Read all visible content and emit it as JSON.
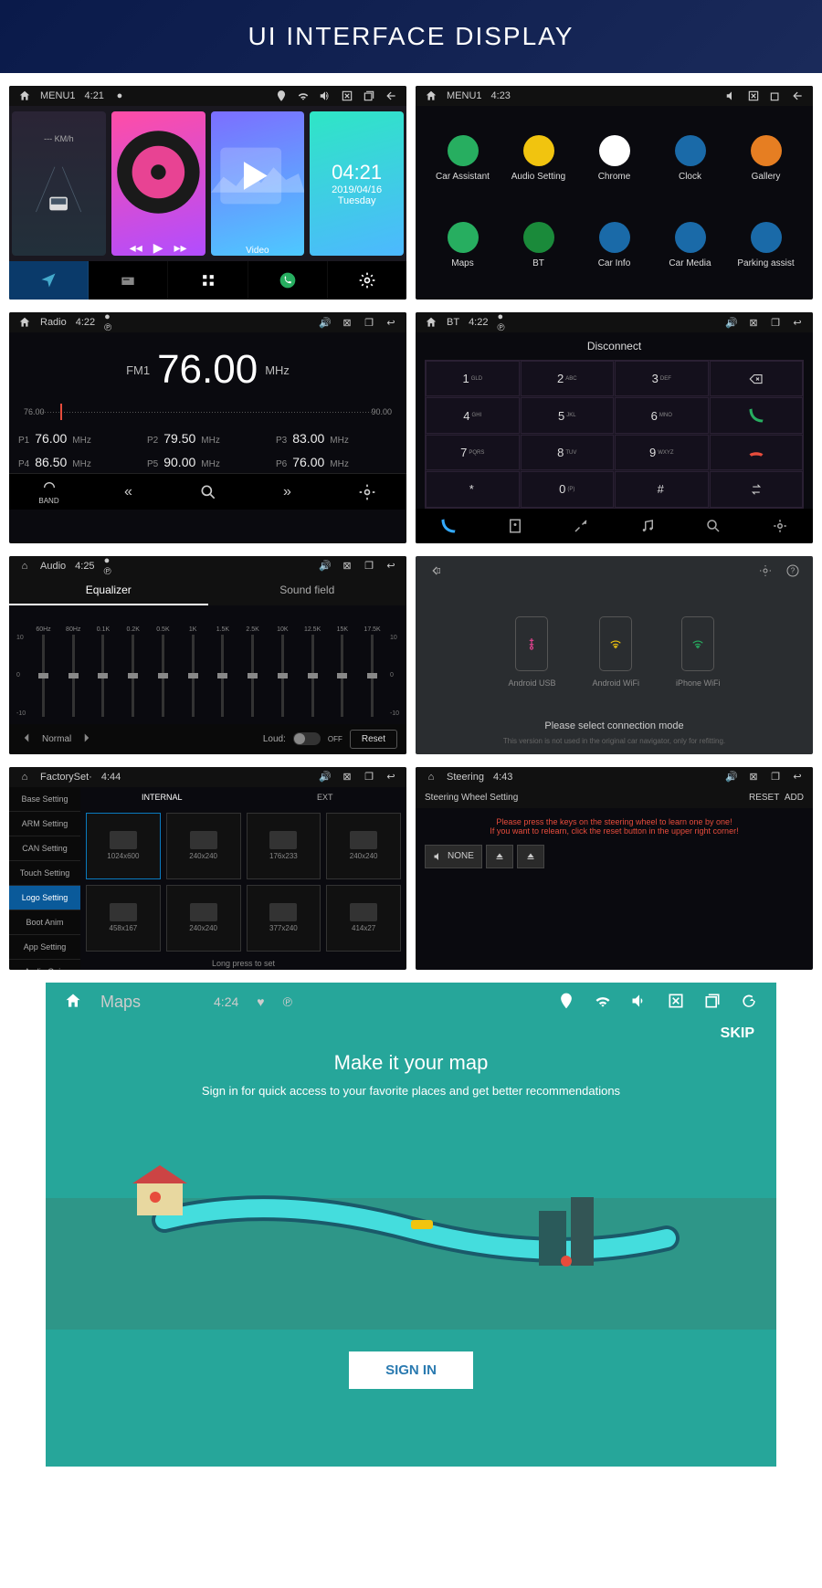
{
  "hero": "UI INTERFACE DISPLAY",
  "p1": {
    "sb_label": "MENU1",
    "sb_time": "4:21",
    "speed_unit": "KM/h",
    "video_label": "Video",
    "date_time": "04:21",
    "date_date": "2019/04/16",
    "date_day": "Tuesday"
  },
  "p2": {
    "sb_label": "MENU1",
    "sb_time": "4:23",
    "apps": [
      {
        "name": "Car Assistant",
        "color": "#27ae60"
      },
      {
        "name": "Audio Setting",
        "color": "#f1c40f"
      },
      {
        "name": "Chrome",
        "color": "#fff"
      },
      {
        "name": "Clock",
        "color": "#1a6aa8"
      },
      {
        "name": "Gallery",
        "color": "#e67e22"
      },
      {
        "name": "Maps",
        "color": "#27ae60"
      },
      {
        "name": "BT",
        "color": "#1a8a3a"
      },
      {
        "name": "Car Info",
        "color": "#1a6aa8"
      },
      {
        "name": "Car Media",
        "color": "#1a6aa8"
      },
      {
        "name": "Parking assist",
        "color": "#1a6aa8"
      }
    ]
  },
  "p3": {
    "sb_label": "Radio",
    "sb_time": "4:22",
    "band": "FM1",
    "freq": "76.00",
    "unit": "MHz",
    "dial_min": "76.00",
    "dial_max": "90.00",
    "presets": [
      {
        "p": "P1",
        "f": "76.00",
        "u": "MHz"
      },
      {
        "p": "P2",
        "f": "79.50",
        "u": "MHz"
      },
      {
        "p": "P3",
        "f": "83.00",
        "u": "MHz"
      },
      {
        "p": "P4",
        "f": "86.50",
        "u": "MHz"
      },
      {
        "p": "P5",
        "f": "90.00",
        "u": "MHz"
      },
      {
        "p": "P6",
        "f": "76.00",
        "u": "MHz"
      }
    ],
    "band_label": "BAND"
  },
  "p4": {
    "sb_label": "BT",
    "sb_time": "4:22",
    "disconnect": "Disconnect",
    "keys": [
      [
        "1",
        "GLD"
      ],
      [
        "2",
        "ABC"
      ],
      [
        "3",
        "DEF"
      ],
      [
        "⌫",
        ""
      ],
      [
        "4",
        "GHI"
      ],
      [
        "5",
        "JKL"
      ],
      [
        "6",
        "MNO"
      ],
      [
        "call",
        ""
      ],
      [
        "7",
        "PQRS"
      ],
      [
        "8",
        "TUV"
      ],
      [
        "9",
        "WXYZ"
      ],
      [
        "end",
        ""
      ],
      [
        "*",
        ""
      ],
      [
        "0",
        "(P)"
      ],
      [
        "#",
        ""
      ],
      [
        "swap",
        ""
      ]
    ]
  },
  "p5": {
    "sb_label": "Audio",
    "sb_time": "4:25",
    "tab_eq": "Equalizer",
    "tab_sf": "Sound field",
    "bands": [
      "60Hz",
      "80Hz",
      "0.1K",
      "0.2K",
      "0.5K",
      "1K",
      "1.5K",
      "2.5K",
      "10K",
      "12.5K",
      "15K",
      "17.5K"
    ],
    "scale_top": "10",
    "scale_mid": "0",
    "scale_bot": "-10",
    "mode": "Normal",
    "loud": "Loud:",
    "off": "OFF",
    "reset": "Reset"
  },
  "p6": {
    "options": [
      {
        "name": "Android USB",
        "color": "#e84393"
      },
      {
        "name": "Android WiFi",
        "color": "#f1c40f"
      },
      {
        "name": "iPhone WiFi",
        "color": "#27ae60"
      }
    ],
    "msg": "Please select connection mode",
    "sub": "This version is not used in the original car navigator, only for refitting."
  },
  "p7": {
    "sb_label": "FactorySet·",
    "sb_time": "4:44",
    "side": [
      "Base Setting",
      "ARM Setting",
      "CAN Setting",
      "Touch Setting",
      "Logo Setting",
      "Boot Anim",
      "App Setting",
      "Audio Gain Setting"
    ],
    "side_active": 4,
    "tab_int": "INTERNAL",
    "tab_ext": "EXT",
    "cells": [
      "1024x600",
      "240x240",
      "176x233",
      "240x240",
      "458x167",
      "240x240",
      "377x240",
      "414x27"
    ],
    "foot": "Long press to set"
  },
  "p8": {
    "sb_label": "Steering",
    "sb_time": "4:43",
    "header": "Steering Wheel Setting",
    "reset": "RESET",
    "add": "ADD",
    "warn1": "Please press the keys on the steering wheel to learn one by one!",
    "warn2": "If you want to relearn, click the reset button in the upper right corner!",
    "btn_none": "NONE"
  },
  "p9": {
    "sb_label": "Maps",
    "sb_time": "4:24",
    "skip": "SKIP",
    "title": "Make it your map",
    "sub": "Sign in for quick access to your favorite places and get better recommendations",
    "signin": "SIGN IN"
  }
}
